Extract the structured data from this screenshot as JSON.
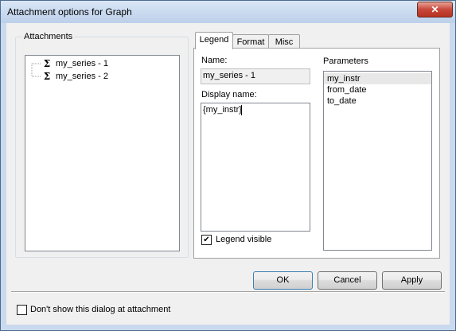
{
  "window": {
    "title": "Attachment options for Graph",
    "close_glyph": "✕"
  },
  "attachments": {
    "label": "Attachments",
    "items": [
      {
        "icon": "sigma-icon",
        "glyph": "Σ",
        "label": "my_series - 1"
      },
      {
        "icon": "sigma-icon",
        "glyph": "Σ",
        "label": "my_series - 2"
      }
    ]
  },
  "tabs": [
    {
      "label": "Legend",
      "active": true
    },
    {
      "label": "Format",
      "active": false
    },
    {
      "label": "Misc",
      "active": false
    }
  ],
  "legend": {
    "name_label": "Name:",
    "name_value": "my_series - 1",
    "display_name_label": "Display name:",
    "display_name_value": "{my_instr}",
    "legend_visible_label": "Legend visible",
    "legend_visible_checked": true,
    "check_glyph": "✔"
  },
  "parameters": {
    "label": "Parameters",
    "items": [
      "my_instr",
      "from_date",
      "to_date"
    ],
    "selected_index": 0
  },
  "buttons": {
    "ok": "OK",
    "cancel": "Cancel",
    "apply": "Apply"
  },
  "footer": {
    "dont_show_label": "Don't show this dialog at attachment",
    "dont_show_checked": false
  }
}
